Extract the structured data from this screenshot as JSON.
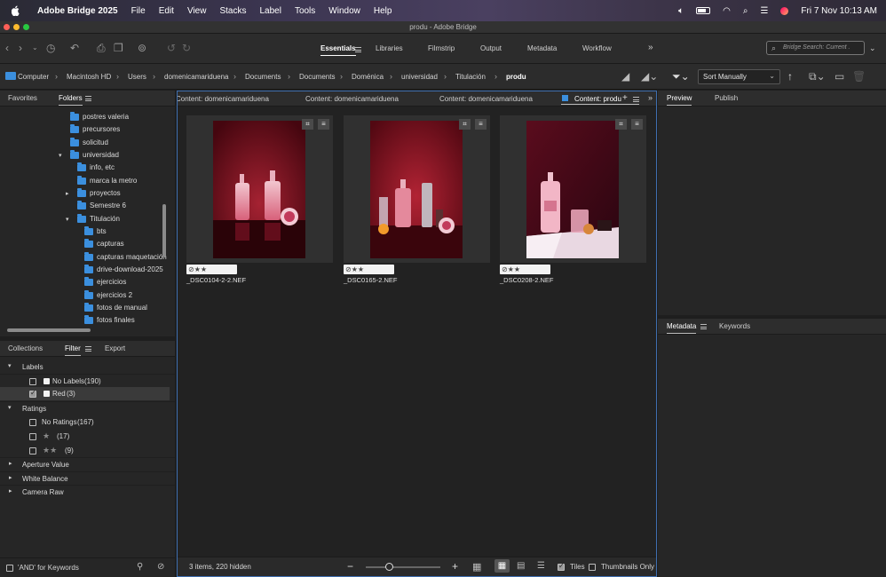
{
  "menubar": {
    "app_name": "Adobe Bridge 2025",
    "items": [
      "File",
      "Edit",
      "View",
      "Stacks",
      "Label",
      "Tools",
      "Window",
      "Help"
    ],
    "datetime": "Fri 7 Nov  10:13 AM"
  },
  "window": {
    "title": "produ - Adobe Bridge"
  },
  "toolbar": {
    "workspaces": [
      "Essentials",
      "Libraries",
      "Filmstrip",
      "Output",
      "Metadata",
      "Workflow"
    ],
    "more": "»",
    "search_placeholder": "Bridge Search: Current ."
  },
  "pathbar": {
    "crumbs": [
      "Computer",
      "Macintosh HD",
      "Users",
      "domenicamariduena",
      "Documents",
      "Documents",
      "Doménica",
      "universidad",
      "Titulación",
      "produ"
    ],
    "sort_label": "Sort Manually"
  },
  "left_top_panel": {
    "tabs": [
      "Favorites",
      "Folders"
    ],
    "folders": [
      {
        "label": "postres valeria"
      },
      {
        "label": "precursores"
      },
      {
        "label": "solicitud"
      },
      {
        "label": "universidad",
        "twisty": "▾"
      },
      {
        "label": "info, etc"
      },
      {
        "label": "marca la metro"
      },
      {
        "label": "proyectos",
        "twisty": "▸"
      },
      {
        "label": "Semestre 6"
      },
      {
        "label": "Titulación",
        "twisty": "▾"
      },
      {
        "label": "bts"
      },
      {
        "label": "capturas"
      },
      {
        "label": "capturas maquetación"
      },
      {
        "label": "drive-download-2025"
      },
      {
        "label": "ejercicios"
      },
      {
        "label": "ejercicios 2"
      },
      {
        "label": "fotos de manual"
      },
      {
        "label": "fotos finales"
      }
    ]
  },
  "left_bottom_panel": {
    "tabs": [
      "Collections",
      "Filter",
      "Export"
    ],
    "sections": {
      "labels": "Labels",
      "ratings": "Ratings",
      "aperture": "Aperture Value",
      "white_balance": "White Balance",
      "camera_raw": "Camera Raw"
    },
    "label_rows": [
      {
        "label": "No Labels",
        "count": "(190)"
      },
      {
        "label": "Red",
        "count": "(3)"
      }
    ],
    "rating_rows": [
      {
        "label": "No Ratings",
        "count": "(167)"
      },
      {
        "stars": "★",
        "count": "(17)"
      },
      {
        "stars": "★★",
        "count": "(9)"
      }
    ],
    "footer_label": "'AND' for Keywords"
  },
  "content": {
    "tabs": [
      "Content: domenicamariduena",
      "Content: domenicamariduena",
      "Content: domenicamariduena",
      "Content: produ"
    ],
    "items": [
      {
        "filename": "_DSC0104-2-2.NEF",
        "rating": "⊘★★"
      },
      {
        "filename": "_DSC0165-2.NEF",
        "rating": "⊘★★"
      },
      {
        "filename": "_DSC0208-2.NEF",
        "rating": "⊘★★"
      }
    ],
    "status": "3 items, 220 hidden",
    "zoom_minus": "−",
    "zoom_plus": "+",
    "tiles_label": "Tiles",
    "thumbs_only_label": "Thumbnails Only"
  },
  "right_top_panel": {
    "tabs": [
      "Preview",
      "Publish"
    ]
  },
  "right_bottom_panel": {
    "tabs": [
      "Metadata",
      "Keywords"
    ]
  },
  "colors": {
    "accent_blue": "#3b8fde",
    "photo_red": "#8a1626"
  }
}
